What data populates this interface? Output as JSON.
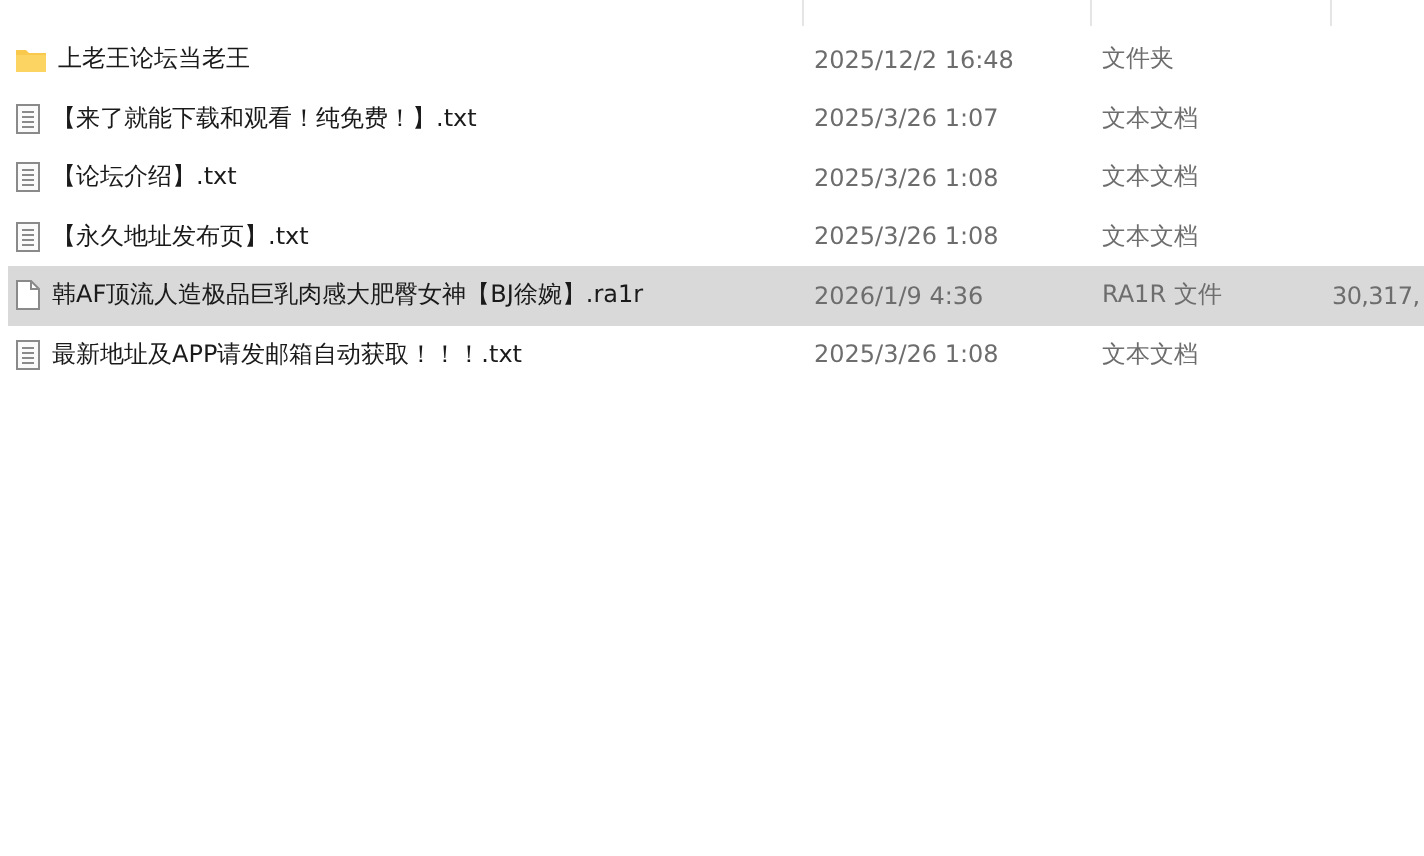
{
  "files": [
    {
      "kind": "folder",
      "name": "上老王论坛当老王",
      "modified": "2025/12/2 16:48",
      "type": "文件夹",
      "selected": false
    },
    {
      "kind": "text",
      "name": "【来了就能下载和观看！纯免费！】.txt",
      "modified": "2025/3/26 1:07",
      "type": "文本文档",
      "selected": false
    },
    {
      "kind": "text",
      "name": "【论坛介绍】.txt",
      "modified": "2025/3/26 1:08",
      "type": "文本文档",
      "selected": false
    },
    {
      "kind": "text",
      "name": "【永久地址发布页】.txt",
      "modified": "2025/3/26 1:08",
      "type": "文本文档",
      "selected": false
    },
    {
      "kind": "blank",
      "name": "韩AF顶流人造极品巨乳肉感大肥臀女神【BJ徐婉】.ra1r",
      "modified": "2026/1/9 4:36",
      "type": "RA1R 文件",
      "size": "30,317,",
      "selected": true
    },
    {
      "kind": "text",
      "name": "最新地址及APP请发邮箱自动获取！！！.txt",
      "modified": "2025/3/26 1:08",
      "type": "文本文档",
      "selected": false
    }
  ]
}
